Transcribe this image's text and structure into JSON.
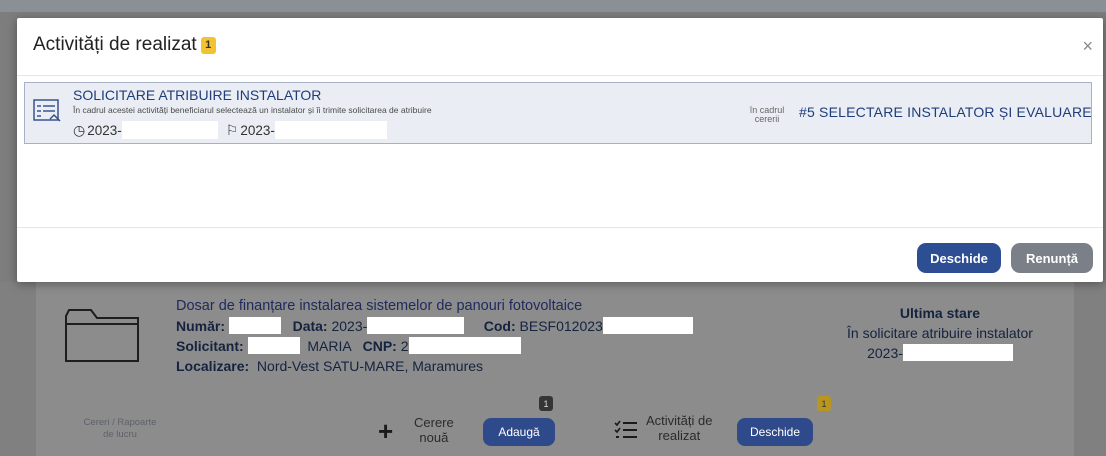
{
  "modal": {
    "title": "Activități de realizat",
    "badge": "1",
    "close": "×",
    "activity": {
      "title": "SOLICITARE ATRIBUIRE INSTALATOR",
      "description": "În cadrul acestei activități beneficiarul selectează un instalator și îi trimite solicitarea de atribuire",
      "start_date": "2023-",
      "due_date": "2023-",
      "context_label_1": "în cadrul",
      "context_label_2": "cererii",
      "status": "#5  SELECTARE INSTALATOR ȘI EVALUARE"
    },
    "buttons": {
      "open": "Deschide",
      "cancel": "Renunță"
    }
  },
  "background": {
    "dosar": {
      "title": "Dosar de finanțare instalarea sistemelor de panouri fotovoltaice",
      "numar_label": "Număr:",
      "data_label": "Data:",
      "data_value": "2023-",
      "cod_label": "Cod:",
      "cod_value": "BESF012023",
      "solicitant_label": "Solicitant:",
      "solicitant_value": "MARIA",
      "cnp_label": "CNP:",
      "cnp_value": "2",
      "localizare_label": "Localizare:",
      "localizare_value": "Nord-Vest SATU-MARE,  Maramures"
    },
    "ultima_stare": {
      "heading": "Ultima stare",
      "status": "În solicitare atribuire instalator",
      "date": "2023-"
    },
    "toolbar": {
      "left_line1": "Cereri / Rapoarte",
      "left_line2": "de lucru",
      "cerere_line1": "Cerere",
      "cerere_line2": "nouă",
      "adauga": "Adaugă",
      "cerere_badge": "1",
      "activitati_line1": "Activități de",
      "activitati_line2": "realizat",
      "deschide": "Deschide",
      "activitati_badge": "1"
    }
  }
}
